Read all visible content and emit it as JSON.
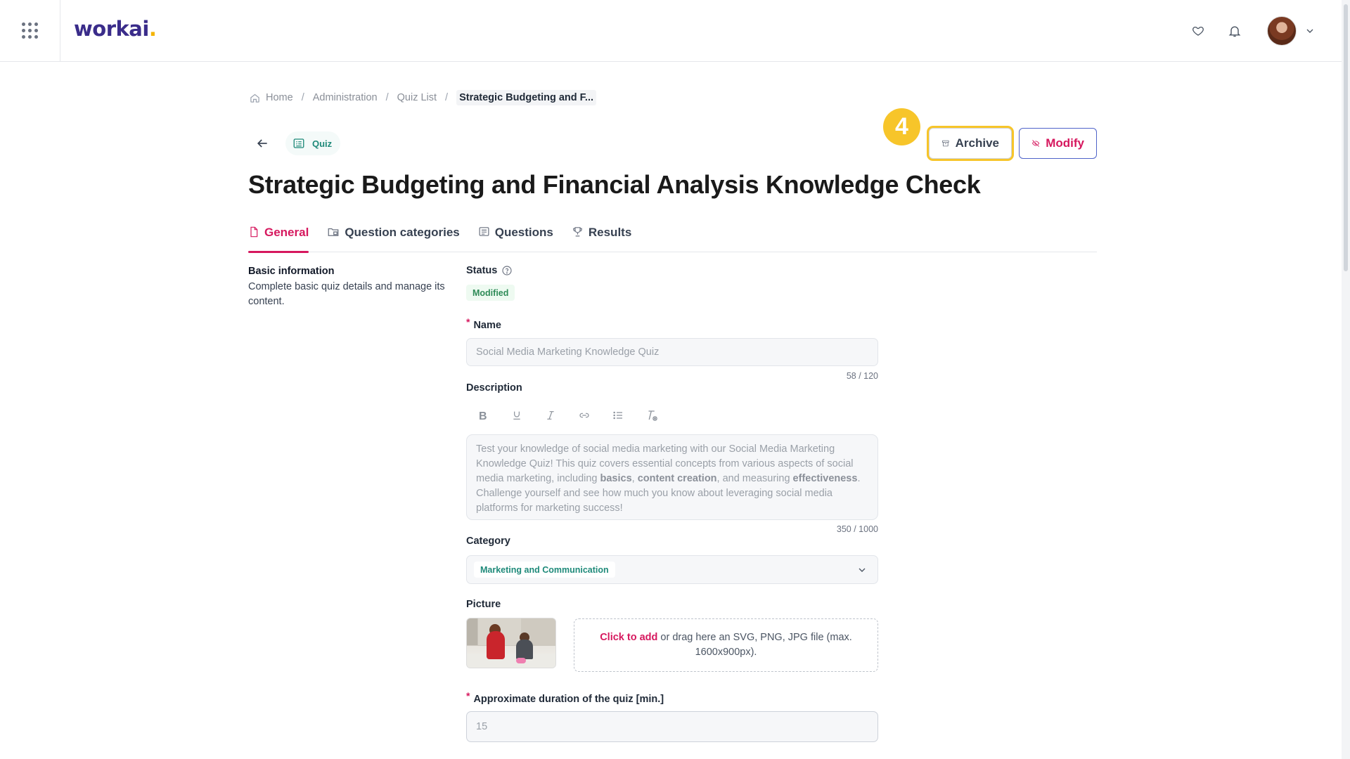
{
  "app": {
    "logo_text": "workai",
    "logo_dot": "."
  },
  "breadcrumb": [
    "Home",
    "Administration",
    "Quiz List",
    "Strategic Budgeting and F..."
  ],
  "header": {
    "type_chip": "Quiz",
    "step_number": "4",
    "archive_label": "Archive",
    "modify_label": "Modify",
    "title": "Strategic Budgeting and Financial Analysis Knowledge Check"
  },
  "tabs": [
    {
      "label": "General",
      "active": true
    },
    {
      "label": "Question categories",
      "active": false
    },
    {
      "label": "Questions",
      "active": false
    },
    {
      "label": "Results",
      "active": false
    }
  ],
  "section": {
    "title": "Basic information",
    "description": "Complete basic quiz details and manage its content."
  },
  "form": {
    "status_label": "Status",
    "status_value": "Modified",
    "name_label": "Name",
    "name_value": "Social Media Marketing Knowledge Quiz",
    "name_counter": "58 / 120",
    "description_label": "Description",
    "description_parts": [
      {
        "text": "Test your knowledge of social media marketing with our Social Media Marketing Knowledge Quiz! This quiz covers essential concepts from various aspects of social media marketing, including ",
        "bold": false
      },
      {
        "text": "basics",
        "bold": true
      },
      {
        "text": ", ",
        "bold": false
      },
      {
        "text": "content creation",
        "bold": true
      },
      {
        "text": ", and measuring ",
        "bold": false
      },
      {
        "text": "effectiveness",
        "bold": true
      },
      {
        "text": ". Challenge yourself and see how much you know about leveraging social media platforms for marketing success!",
        "bold": false
      }
    ],
    "description_counter": "350 / 1000",
    "category_label": "Category",
    "category_value": "Marketing and Communication",
    "picture_label": "Picture",
    "dropzone_link": "Click to add",
    "dropzone_text": " or drag here an SVG, PNG, JPG file (max. 1600x900px).",
    "duration_label": "Approximate duration of the quiz [min.]",
    "duration_value": "15"
  },
  "colors": {
    "brand": "#3a2c8a",
    "accent": "#d6185e",
    "highlight": "#f7c52a",
    "teal": "#1f8a7a"
  }
}
